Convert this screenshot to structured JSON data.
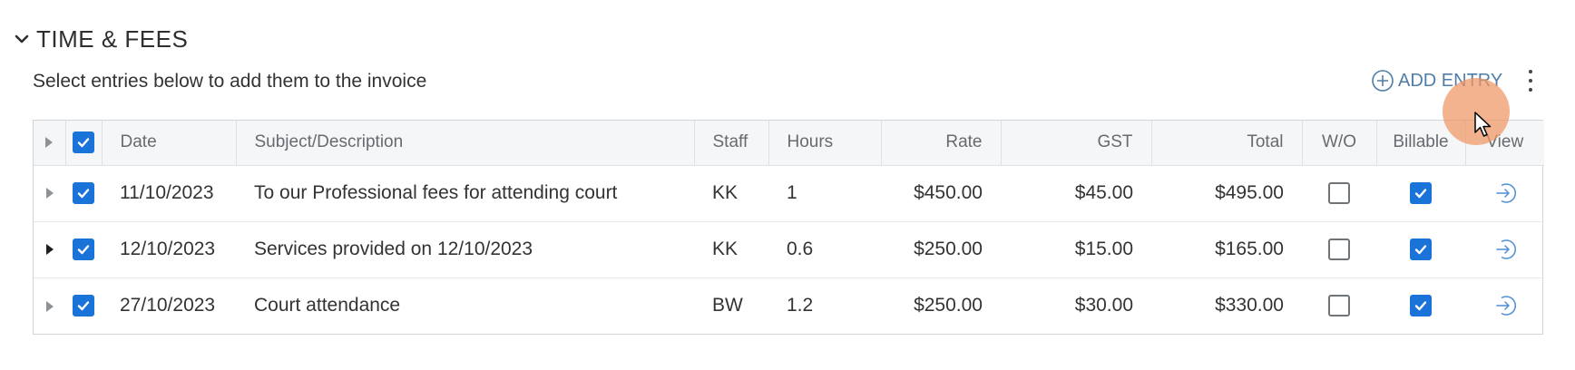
{
  "section": {
    "title": "TIME & FEES",
    "subtitle": "Select entries below to add them to the invoice"
  },
  "actions": {
    "add_entry_label": "ADD ENTRY"
  },
  "table": {
    "headers": {
      "date": "Date",
      "subject": "Subject/Description",
      "staff": "Staff",
      "hours": "Hours",
      "rate": "Rate",
      "gst": "GST",
      "total": "Total",
      "wo": "W/O",
      "billable": "Billable",
      "view": "View"
    },
    "header_select_all": true,
    "rows": [
      {
        "date": "11/10/2023",
        "subject": "To our Professional fees for attending court",
        "staff": "KK",
        "hours": "1",
        "rate": "$450.00",
        "gst": "$45.00",
        "total": "$495.00",
        "selected": true,
        "wo": false,
        "billable": true
      },
      {
        "date": "12/10/2023",
        "subject": "Services provided on 12/10/2023",
        "staff": "KK",
        "hours": "0.6",
        "rate": "$250.00",
        "gst": "$15.00",
        "total": "$165.00",
        "selected": true,
        "wo": false,
        "billable": true
      },
      {
        "date": "27/10/2023",
        "subject": "Court attendance",
        "staff": "BW",
        "hours": "1.2",
        "rate": "$250.00",
        "gst": "$30.00",
        "total": "$330.00",
        "selected": true,
        "wo": false,
        "billable": true
      }
    ]
  },
  "colors": {
    "accent": "#1a73d9",
    "link": "#4f7da8",
    "cursor_highlight": "#f0965f"
  }
}
